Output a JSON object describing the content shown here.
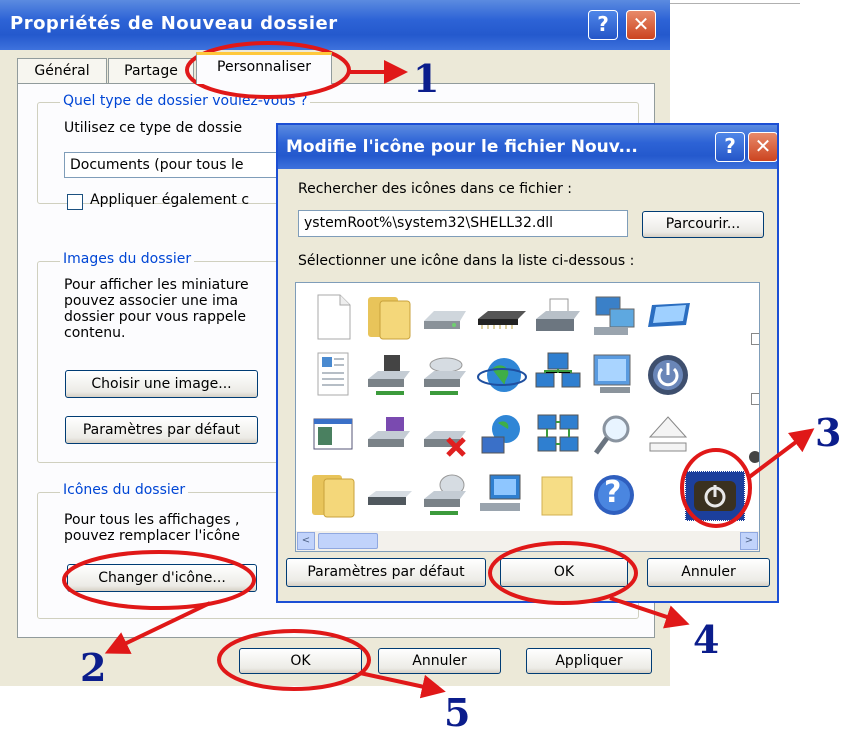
{
  "outer_dialog": {
    "title": "Propriétés de Nouveau dossier",
    "help_glyph": "?",
    "close_glyph": "✕",
    "tabs": [
      {
        "label": "Général"
      },
      {
        "label": "Partage"
      },
      {
        "label": "Personnaliser"
      }
    ],
    "group_type": {
      "title": "Quel type de dossier voulez-vous ?",
      "prompt": "Utilisez ce type de dossie",
      "select_value": "Documents (pour tous le",
      "checkbox_label": "Appliquer également c"
    },
    "group_images": {
      "title": "Images du dossier",
      "description": [
        "Pour afficher les miniature",
        "pouvez associer une ima",
        "dossier pour vous rappele",
        "contenu."
      ],
      "choose_button": "Choisir une image...",
      "default_button": "Paramètres par défaut"
    },
    "group_icons": {
      "title": "Icônes du dossier",
      "description": [
        "Pour tous les affichages ,",
        "pouvez remplacer l'icône"
      ],
      "change_button": "Changer d'icône..."
    },
    "buttons": {
      "ok": "OK",
      "cancel": "Annuler",
      "apply": "Appliquer"
    }
  },
  "inner_dialog": {
    "title": "Modifie l'icône pour le fichier Nouv...",
    "help_glyph": "?",
    "close_glyph": "✕",
    "search_label": "Rechercher des icônes dans ce fichier :",
    "file_path": "ystemRoot%\\system32\\SHELL32.dll",
    "browse_button": "Parcourir...",
    "select_label": "Sélectionner une icône dans la liste ci-dessous :",
    "icons": [
      [
        "blank-document-icon",
        "folder-icon",
        "drive-icon",
        "memory-chip-icon",
        "printer-icon",
        "network-computer-icon",
        "monitor-icon"
      ],
      [
        "text-document-icon",
        "network-drive-icon",
        "cd-drive-icon",
        "globe-icon",
        "network-icon",
        "control-panel-icon",
        "power-icon"
      ],
      [
        "window-icon",
        "floppy-drive-icon",
        "disconnected-drive-icon",
        "web-network-icon",
        "network-places-icon",
        "search-icon",
        "eject-icon"
      ],
      [
        "folder-icon",
        "removable-drive-icon",
        "network-disk-icon",
        "computer-icon",
        "blank-folder-icon",
        "help-icon",
        "shutdown-icon"
      ]
    ],
    "selected_icon": "shutdown-icon",
    "help_glyph_icon": "?",
    "scroll_left": "<",
    "scroll_right": ">",
    "buttons": {
      "default": "Paramètres par défaut",
      "ok": "OK",
      "cancel": "Annuler"
    }
  },
  "annotations": [
    "1",
    "2",
    "3",
    "4",
    "5"
  ],
  "colors": {
    "annotation_red": "#e01818",
    "annotation_blue": "#0b1d8c",
    "titlebar_blue": "#2459cd",
    "dialog_bg": "#ece9d8"
  }
}
